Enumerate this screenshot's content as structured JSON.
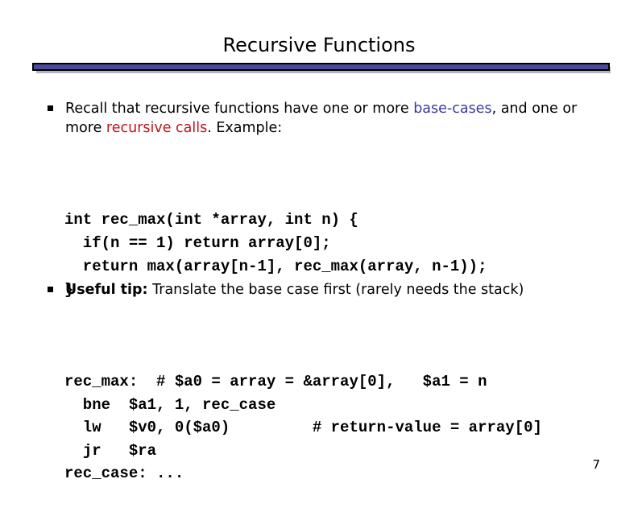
{
  "slide": {
    "title": "Recursive Functions",
    "page_number": "7"
  },
  "bullet1": {
    "part1": "Recall that recursive functions have one or more ",
    "highlight_blue": "base-cases",
    "part2": ", and one or",
    "line2_prefix": "more ",
    "highlight_red": "recursive calls",
    "line2_suffix": ". Example:"
  },
  "c_code": {
    "lines": [
      "int rec_max(int *array, int n) {",
      "  if(n == 1) return array[0];",
      "  return max(array[n-1], rec_max(array, n-1));",
      "}"
    ]
  },
  "bullet2": {
    "bold": "Useful tip:",
    "rest": " Translate the base case first (rarely needs the stack)"
  },
  "asm_code": {
    "lines": [
      "rec_max:  # $a0 = array = &array[0],   $a1 = n",
      "  bne  $a1, 1, rec_case",
      "  lw   $v0, 0($a0)         # return-value = array[0]",
      "  jr   $ra",
      "rec_case: ..."
    ]
  },
  "colors": {
    "accent_bar": "#4a4a9a",
    "base_case_blue": "#3b3ba0",
    "recursive_red": "#c0141c"
  }
}
